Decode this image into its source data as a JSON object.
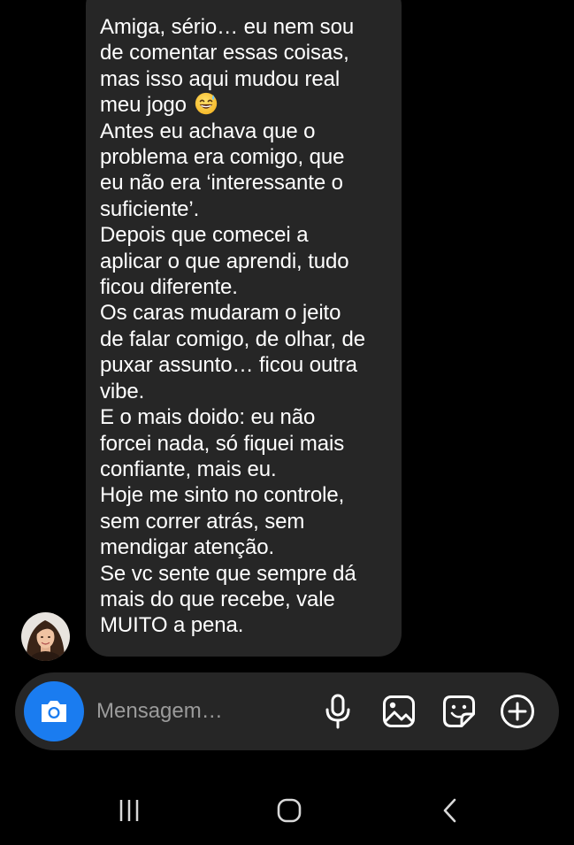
{
  "chat": {
    "message_lines": [
      "Amiga, sério… eu nem sou",
      "de comentar essas coisas,",
      "mas isso aqui mudou real",
      "meu jogo",
      "Antes eu achava que o",
      "problema era comigo, que",
      "eu não era ‘interessante o",
      "suficiente’.",
      "Depois que comecei a",
      "aplicar o que aprendi, tudo",
      "ficou diferente.",
      "Os caras mudaram o jeito",
      "de falar comigo, de olhar, de",
      "puxar assunto… ficou outra",
      "vibe.",
      "E o mais doido: eu não",
      "forcei nada, só fiquei mais",
      "confiante, mais eu.",
      "Hoje me sinto no controle,",
      "sem correr atrás, sem",
      "mendigar atenção.",
      "Se vc sente que sempre dá",
      "mais do que recebe, vale",
      "MUITO a pena."
    ],
    "emoji": "grinning-face-with-sweat",
    "bubble_color": "#262626"
  },
  "composer": {
    "placeholder": "Mensagem…",
    "value": "",
    "camera_color": "#1a7cf0",
    "icons": [
      "camera-icon",
      "microphone-icon",
      "gallery-icon",
      "sticker-icon",
      "plus-circle-icon"
    ]
  },
  "navbar": {
    "icons": [
      "recent-apps-icon",
      "home-icon",
      "back-icon"
    ]
  }
}
